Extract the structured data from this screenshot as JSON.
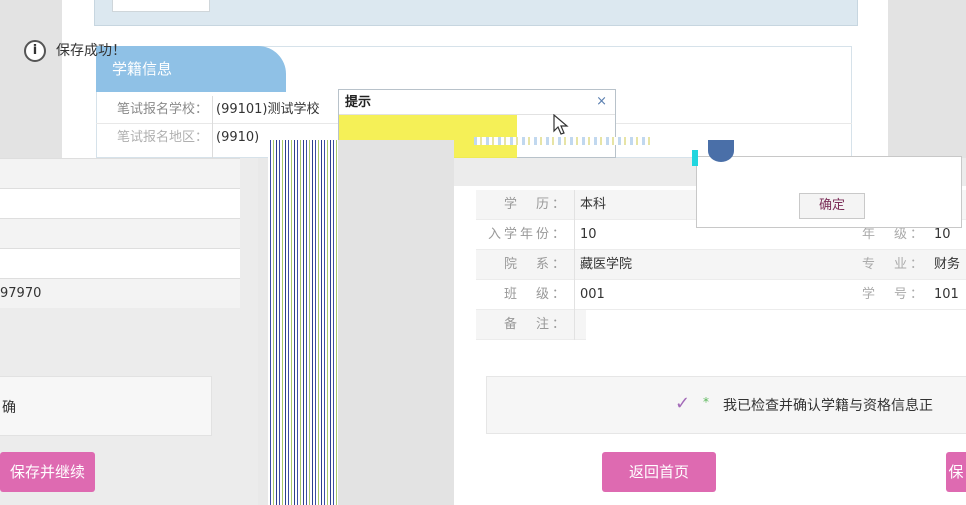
{
  "section": {
    "title": "学籍信息"
  },
  "upper_rows": [
    {
      "label": "笔试报名学校：",
      "value": "(99101)测试学校"
    },
    {
      "label": "笔试报名地区：",
      "value": "(9910)"
    }
  ],
  "dialog": {
    "title": "提示",
    "close": "×",
    "message": "保存成功！",
    "info_icon": "i"
  },
  "left_fragment": {
    "id_fragment": "97970",
    "confirm_fragment": "确",
    "save_continue_fragment": "保存并继续"
  },
  "detail_rows": [
    {
      "label": "学　历：",
      "value": "本科",
      "label2": "",
      "value2": ""
    },
    {
      "label": "入学年份：",
      "value": "10",
      "label2": "年　级：",
      "value2": "10"
    },
    {
      "label": "院　系：",
      "value": "藏医学院",
      "label2": "专　业：",
      "value2": "财务"
    },
    {
      "label": "班　级：",
      "value": "001",
      "label2": "学　号：",
      "value2": "101"
    },
    {
      "label": "备　注：",
      "value": "",
      "label2": "",
      "value2": ""
    }
  ],
  "confirm": {
    "star": "*",
    "text": "我已检查并确认学籍与资格信息正"
  },
  "ok_dialog": {
    "ok_label": "确定"
  },
  "buttons": {
    "home": "返回首页",
    "right_fragment": "保"
  },
  "colors": {
    "accent": "#de6ab1",
    "section_tab": "#8fc1e6",
    "highlight": "#f4ef49"
  }
}
